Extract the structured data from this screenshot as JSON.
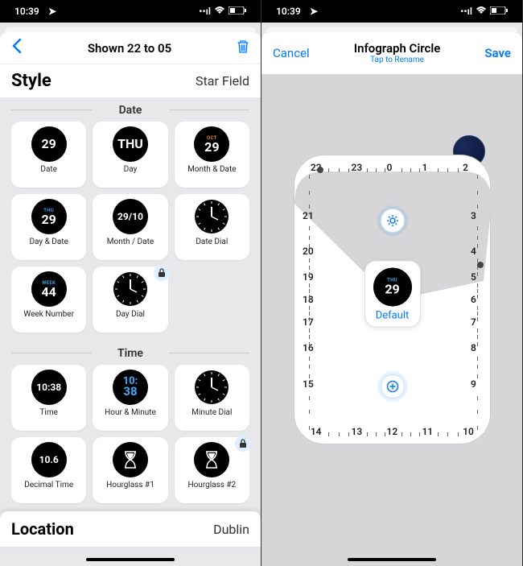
{
  "status": {
    "time": "10:39",
    "loc_icon": "➤",
    "signal": "••ıı",
    "wifi": "📶",
    "battery": "🔋"
  },
  "left": {
    "nav": {
      "title": "Shown 22 to 05"
    },
    "style": {
      "label": "Style",
      "value": "Star Field"
    },
    "sections": {
      "date": {
        "title": "Date",
        "tiles": [
          {
            "id": "date",
            "label": "Date",
            "icon": {
              "lines": [
                "29"
              ]
            }
          },
          {
            "id": "day",
            "label": "Day",
            "icon": {
              "lines": [
                "THU"
              ]
            }
          },
          {
            "id": "month-date",
            "label": "Month & Date",
            "icon": {
              "top": "OCT",
              "top_color": "orange",
              "lines": [
                "29"
              ]
            }
          },
          {
            "id": "day-date",
            "label": "Day & Date",
            "icon": {
              "top": "THU",
              "top_color": "blue",
              "lines": [
                "29"
              ]
            }
          },
          {
            "id": "month-slash-date",
            "label": "Month / Date",
            "icon": {
              "lines": [
                "29/10"
              ]
            }
          },
          {
            "id": "date-dial",
            "label": "Date Dial",
            "icon": {
              "dial": true
            }
          },
          {
            "id": "week-number",
            "label": "Week Number",
            "icon": {
              "top": "WEEK",
              "top_color": "blue",
              "lines": [
                "44"
              ]
            }
          },
          {
            "id": "day-dial",
            "label": "Day Dial",
            "icon": {
              "dial": true
            },
            "locked": true
          }
        ]
      },
      "time": {
        "title": "Time",
        "tiles": [
          {
            "id": "time",
            "label": "Time",
            "icon": {
              "lines": [
                "10:38"
              ]
            }
          },
          {
            "id": "hour-minute",
            "label": "Hour & Minute",
            "icon": {
              "stack": [
                "10:",
                "38"
              ],
              "color": "blue"
            }
          },
          {
            "id": "minute-dial",
            "label": "Minute Dial",
            "icon": {
              "dial": true
            }
          },
          {
            "id": "decimal-time",
            "label": "Decimal Time",
            "icon": {
              "lines": [
                "10.6"
              ]
            }
          },
          {
            "id": "hourglass-1",
            "label": "Hourglass #1",
            "icon": {
              "hourglass": true
            }
          },
          {
            "id": "hourglass-2",
            "label": "Hourglass #2",
            "icon": {
              "hourglass": true
            },
            "locked": true
          }
        ]
      }
    },
    "location": {
      "label": "Location",
      "value": "Dublin"
    }
  },
  "right": {
    "nav": {
      "cancel": "Cancel",
      "title": "Infograph Circle",
      "subtitle": "Tap to Rename",
      "save": "Save"
    },
    "hours": [
      "22",
      "23",
      "0",
      "1",
      "2",
      "3",
      "4",
      "5",
      "6",
      "7",
      "8",
      "9",
      "10",
      "11",
      "12",
      "13",
      "14",
      "15",
      "16",
      "17",
      "18",
      "19",
      "20",
      "21"
    ],
    "center": {
      "top": "THU",
      "main": "29",
      "label": "Default"
    },
    "gear": "⚙",
    "plus": "⊕"
  }
}
